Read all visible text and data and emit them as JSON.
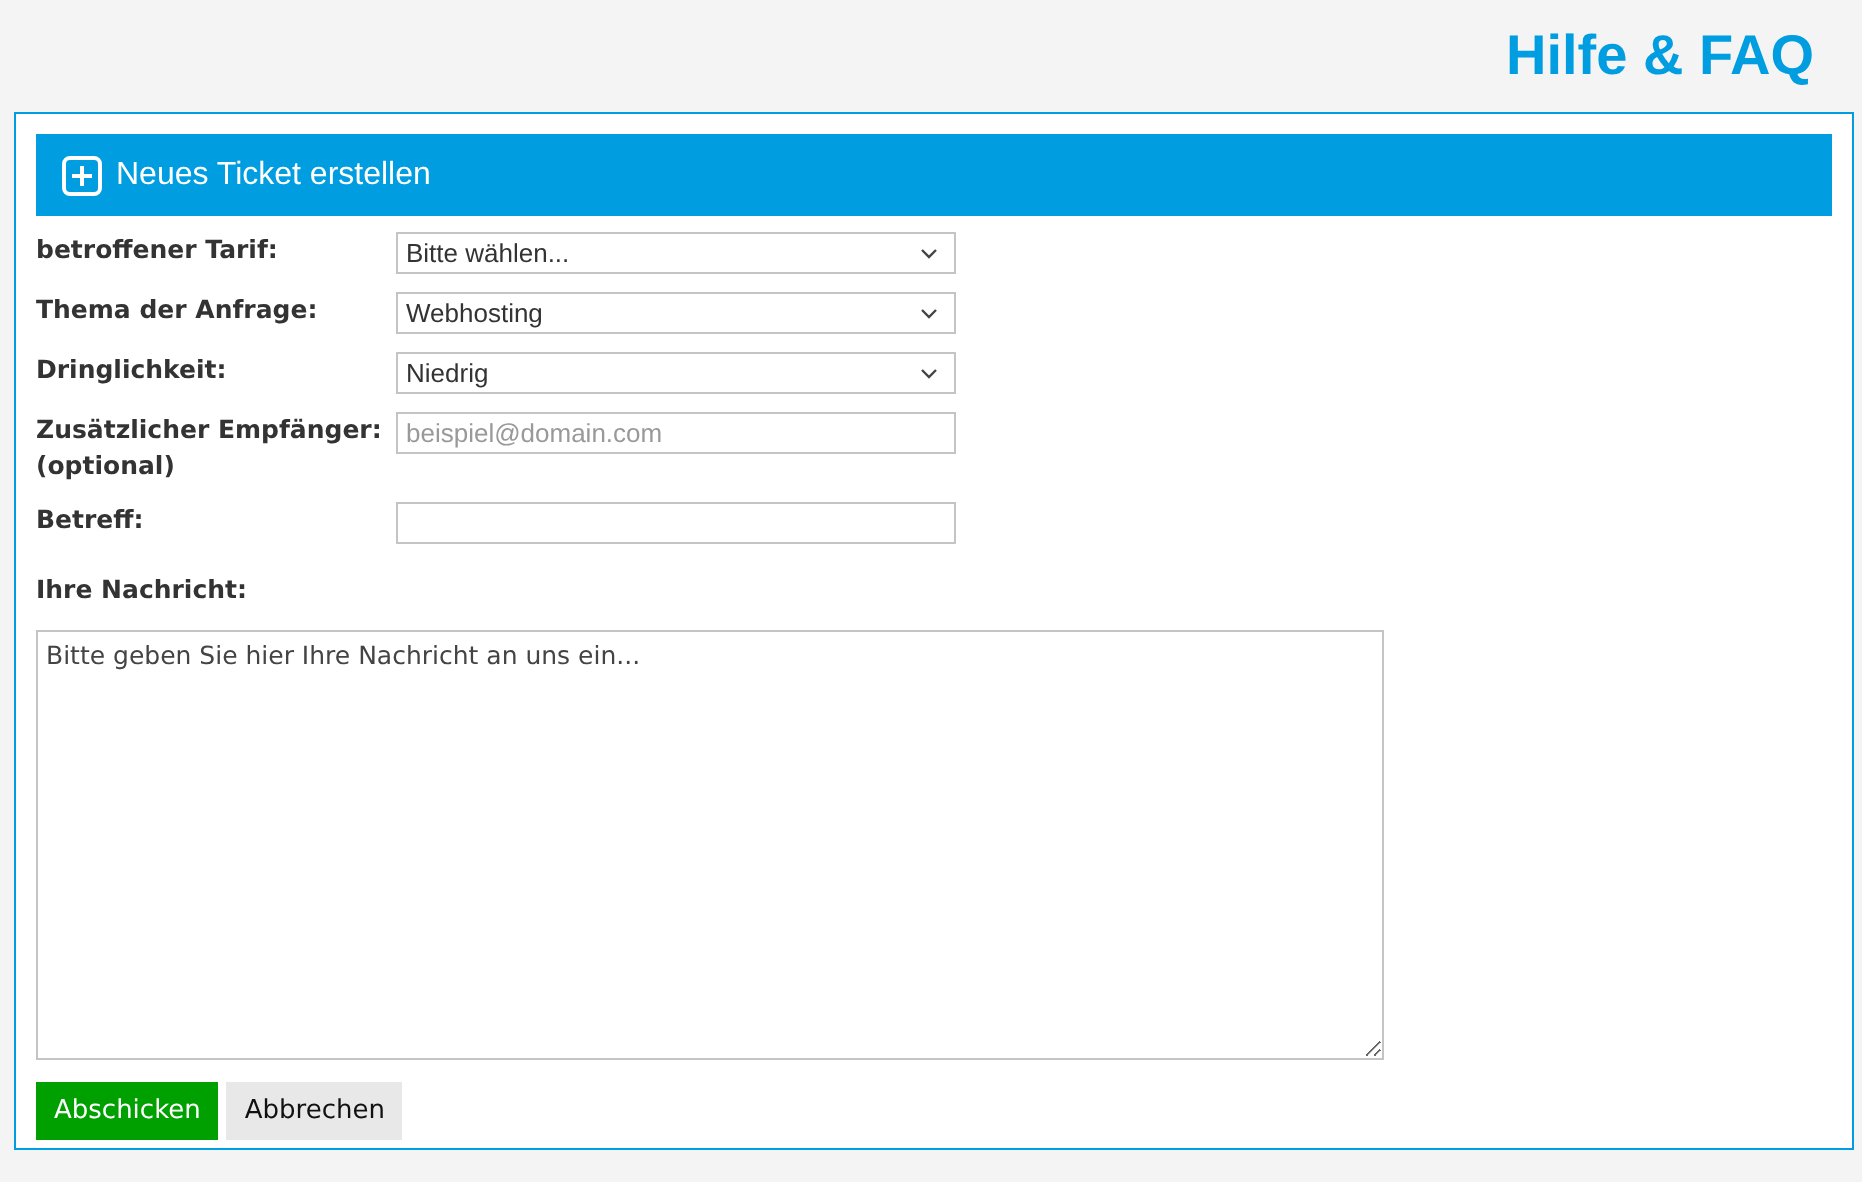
{
  "page_title": "Hilfe & FAQ",
  "panel": {
    "header": "Neues Ticket erstellen"
  },
  "fields": [
    {
      "kind": "select",
      "label": "betroffener Tarif:",
      "value": "Bitte wählen..."
    },
    {
      "kind": "select",
      "label": "Thema der Anfrage:",
      "value": "Webhosting"
    },
    {
      "kind": "select",
      "label": "Dringlichkeit:",
      "value": "Niedrig"
    },
    {
      "kind": "input",
      "label": "Zusätzlicher Empfänger: (optional)",
      "placeholder": "beispiel@domain.com"
    },
    {
      "kind": "input",
      "label": "Betreff:"
    }
  ],
  "message": {
    "label": "Ihre Nachricht:",
    "placeholder": "Bitte geben Sie hier Ihre Nachricht an uns ein..."
  },
  "buttons": [
    {
      "kind": "primary",
      "label": "Abschicken"
    },
    {
      "kind": "secondary",
      "label": "Abbrechen"
    }
  ]
}
